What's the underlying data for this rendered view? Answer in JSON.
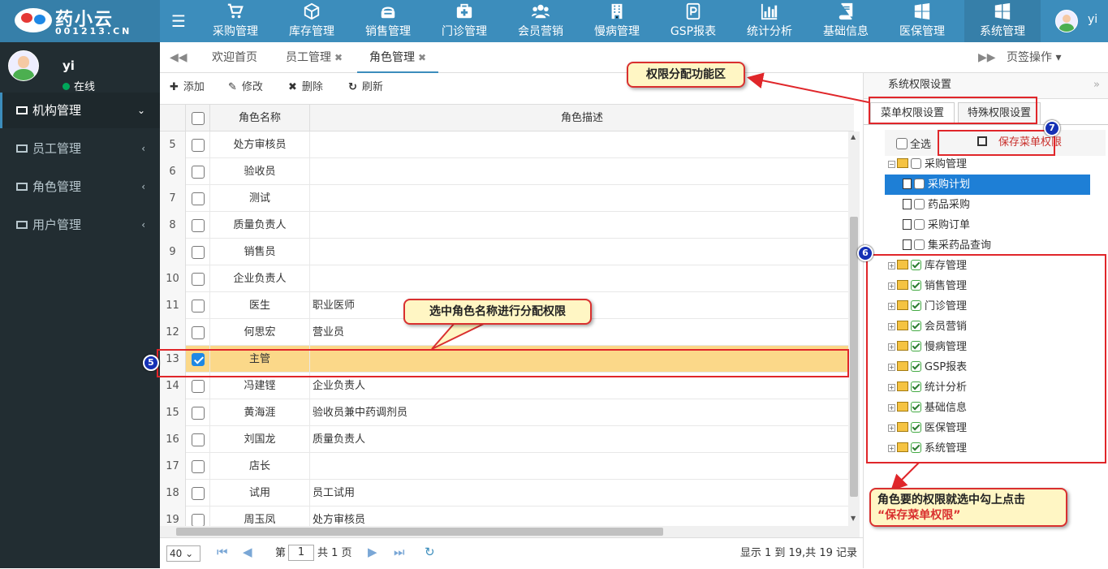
{
  "app": {
    "logo_text": "药小云",
    "logo_sub": "001213.CN"
  },
  "topnav": [
    {
      "label": "采购管理",
      "icon": "cart-icon"
    },
    {
      "label": "库存管理",
      "icon": "box-icon"
    },
    {
      "label": "销售管理",
      "icon": "cashier-icon"
    },
    {
      "label": "门诊管理",
      "icon": "medkit-icon"
    },
    {
      "label": "会员营销",
      "icon": "users-icon"
    },
    {
      "label": "慢病管理",
      "icon": "building-icon"
    },
    {
      "label": "GSP报表",
      "icon": "report-icon"
    },
    {
      "label": "统计分析",
      "icon": "barchart-icon"
    },
    {
      "label": "基础信息",
      "icon": "book-icon"
    },
    {
      "label": "医保管理",
      "icon": "windows-icon"
    },
    {
      "label": "系统管理",
      "icon": "windows-icon"
    }
  ],
  "user": {
    "name": "yi",
    "status": "在线"
  },
  "sidebar": {
    "items": [
      {
        "label": "机构管理",
        "arrow": "⌄"
      },
      {
        "label": "员工管理",
        "arrow": "‹"
      },
      {
        "label": "角色管理",
        "arrow": "‹"
      },
      {
        "label": "用户管理",
        "arrow": "‹"
      }
    ]
  },
  "tabs": [
    {
      "label": "欢迎首页"
    },
    {
      "label": "员工管理"
    },
    {
      "label": "角色管理"
    }
  ],
  "tab_ops": "页签操作",
  "toolbar": {
    "add": "添加",
    "edit": "修改",
    "delete": "删除",
    "refresh": "刷新"
  },
  "grid": {
    "col_name": "角色名称",
    "col_desc": "角色描述",
    "rows": [
      {
        "num": "5",
        "name": "处方审核员",
        "desc": ""
      },
      {
        "num": "6",
        "name": "验收员",
        "desc": ""
      },
      {
        "num": "7",
        "name": "测试",
        "desc": ""
      },
      {
        "num": "8",
        "name": "质量负责人",
        "desc": ""
      },
      {
        "num": "9",
        "name": "销售员",
        "desc": ""
      },
      {
        "num": "10",
        "name": "企业负责人",
        "desc": ""
      },
      {
        "num": "11",
        "name": "医生",
        "desc": "职业医师"
      },
      {
        "num": "12",
        "name": "何思宏",
        "desc": "营业员"
      },
      {
        "num": "13",
        "name": "主管",
        "desc": ""
      },
      {
        "num": "14",
        "name": "冯建铿",
        "desc": "企业负责人"
      },
      {
        "num": "15",
        "name": "黄海涯",
        "desc": "验收员兼中药调剂员"
      },
      {
        "num": "16",
        "name": "刘国龙",
        "desc": "质量负责人"
      },
      {
        "num": "17",
        "name": "店长",
        "desc": ""
      },
      {
        "num": "18",
        "name": "试用",
        "desc": "员工试用"
      },
      {
        "num": "19",
        "name": "周玉凤",
        "desc": "处方审核员"
      }
    ]
  },
  "pager": {
    "page_size": "40",
    "page_prefix": "第",
    "page": "1",
    "page_suffix": "共 1 页",
    "info": "显示 1 到 19,共 19 记录"
  },
  "rights": {
    "title": "系统权限设置",
    "tab_menu": "菜单权限设置",
    "tab_special": "特殊权限设置",
    "select_all": "全选",
    "save": "保存菜单权限",
    "tree": [
      {
        "label": "采购管理"
      },
      {
        "label": "采购计划"
      },
      {
        "label": "药品采购"
      },
      {
        "label": "采购订单"
      },
      {
        "label": "集采药品查询"
      },
      {
        "label": "库存管理"
      },
      {
        "label": "销售管理"
      },
      {
        "label": "门诊管理"
      },
      {
        "label": "会员营销"
      },
      {
        "label": "慢病管理"
      },
      {
        "label": "GSP报表"
      },
      {
        "label": "统计分析"
      },
      {
        "label": "基础信息"
      },
      {
        "label": "医保管理"
      },
      {
        "label": "系统管理"
      }
    ]
  },
  "annotations": {
    "area": "权限分配功能区",
    "select_role": "选中角色名称进行分配权限",
    "tip_line1": "角色要的权限就选中勾上点击",
    "tip_line2": "“保存菜单权限”",
    "badge5": "5",
    "badge6": "6",
    "badge7": "7"
  },
  "colors": {
    "header": "#3c8dbc",
    "sidebar": "#222d32",
    "selected_row": "#fbd889",
    "annotation_red": "#e0262a"
  }
}
